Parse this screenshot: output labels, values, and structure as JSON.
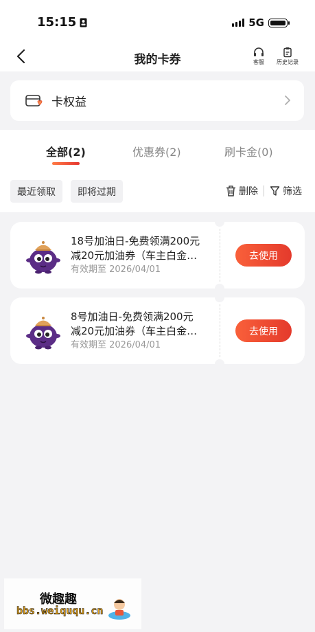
{
  "status_bar": {
    "time": "15:15",
    "network": "5G"
  },
  "header": {
    "title": "我的卡券",
    "service_label": "客服",
    "history_label": "历史记录"
  },
  "benefits": {
    "label": "卡权益"
  },
  "tabs": [
    {
      "label": "全部(2)",
      "active": true
    },
    {
      "label": "优惠券(2)",
      "active": false
    },
    {
      "label": "刷卡金(0)",
      "active": false
    }
  ],
  "filters": {
    "recent": "最近领取",
    "expiring": "即将过期",
    "delete": "删除",
    "filter": "筛选"
  },
  "coupons": [
    {
      "title_line1": "18号加油日-免费领满200元",
      "title_line2": "减20元加油券（车主白金…",
      "expiry": "有效期至 2026/04/01",
      "button": "去使用"
    },
    {
      "title_line1": "8号加油日-免费领满200元",
      "title_line2": "减20元加油券（车主白金…",
      "expiry": "有效期至 2026/04/01",
      "button": "去使用"
    }
  ],
  "watermark": {
    "name": "微趣趣",
    "url": "bbs.weiququ.cn"
  },
  "colors": {
    "accent": "#e8402f",
    "background": "#f3f3f5",
    "mascot": "#5b2d86"
  }
}
